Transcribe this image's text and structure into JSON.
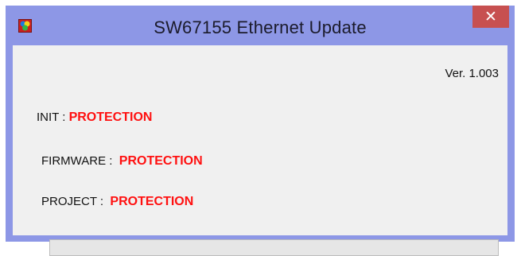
{
  "window": {
    "title": "SW67155 Ethernet Update",
    "close_symbol": "✕"
  },
  "version": "Ver. 1.003",
  "rows": {
    "init": {
      "label": "INIT : ",
      "value": "PROTECTION"
    },
    "firmware": {
      "label": "FIRMWARE :  ",
      "value": "PROTECTION"
    },
    "project": {
      "label": "PROJECT :  ",
      "value": "PROTECTION"
    }
  },
  "progress": {
    "fraction": 0
  },
  "icons": {
    "app": "app-icon",
    "close": "close-icon"
  },
  "colors": {
    "titlebar": "#8d97e6",
    "close_button": "#c75050",
    "value_text": "#ff1010"
  }
}
